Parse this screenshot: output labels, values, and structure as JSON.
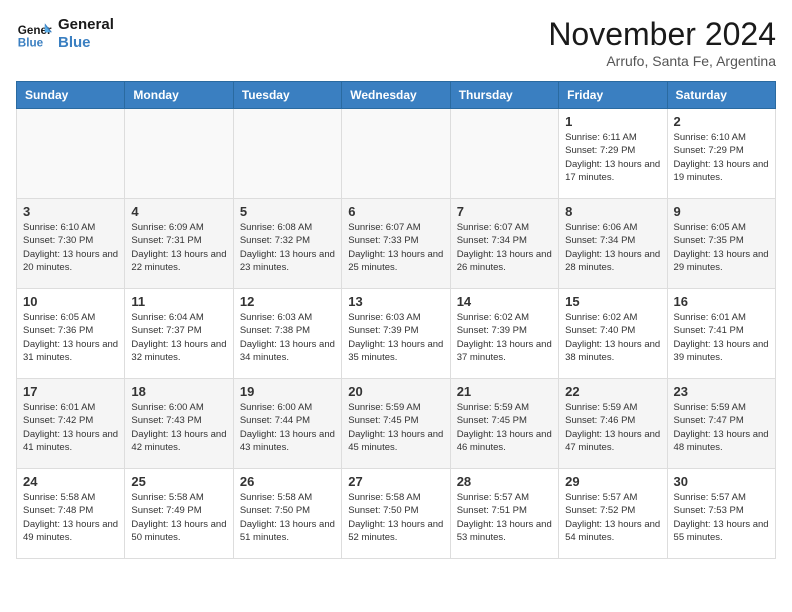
{
  "header": {
    "logo_line1": "General",
    "logo_line2": "Blue",
    "month_title": "November 2024",
    "subtitle": "Arrufo, Santa Fe, Argentina"
  },
  "weekdays": [
    "Sunday",
    "Monday",
    "Tuesday",
    "Wednesday",
    "Thursday",
    "Friday",
    "Saturday"
  ],
  "weeks": [
    [
      {
        "day": "",
        "info": ""
      },
      {
        "day": "",
        "info": ""
      },
      {
        "day": "",
        "info": ""
      },
      {
        "day": "",
        "info": ""
      },
      {
        "day": "",
        "info": ""
      },
      {
        "day": "1",
        "info": "Sunrise: 6:11 AM\nSunset: 7:29 PM\nDaylight: 13 hours and 17 minutes."
      },
      {
        "day": "2",
        "info": "Sunrise: 6:10 AM\nSunset: 7:29 PM\nDaylight: 13 hours and 19 minutes."
      }
    ],
    [
      {
        "day": "3",
        "info": "Sunrise: 6:10 AM\nSunset: 7:30 PM\nDaylight: 13 hours and 20 minutes."
      },
      {
        "day": "4",
        "info": "Sunrise: 6:09 AM\nSunset: 7:31 PM\nDaylight: 13 hours and 22 minutes."
      },
      {
        "day": "5",
        "info": "Sunrise: 6:08 AM\nSunset: 7:32 PM\nDaylight: 13 hours and 23 minutes."
      },
      {
        "day": "6",
        "info": "Sunrise: 6:07 AM\nSunset: 7:33 PM\nDaylight: 13 hours and 25 minutes."
      },
      {
        "day": "7",
        "info": "Sunrise: 6:07 AM\nSunset: 7:34 PM\nDaylight: 13 hours and 26 minutes."
      },
      {
        "day": "8",
        "info": "Sunrise: 6:06 AM\nSunset: 7:34 PM\nDaylight: 13 hours and 28 minutes."
      },
      {
        "day": "9",
        "info": "Sunrise: 6:05 AM\nSunset: 7:35 PM\nDaylight: 13 hours and 29 minutes."
      }
    ],
    [
      {
        "day": "10",
        "info": "Sunrise: 6:05 AM\nSunset: 7:36 PM\nDaylight: 13 hours and 31 minutes."
      },
      {
        "day": "11",
        "info": "Sunrise: 6:04 AM\nSunset: 7:37 PM\nDaylight: 13 hours and 32 minutes."
      },
      {
        "day": "12",
        "info": "Sunrise: 6:03 AM\nSunset: 7:38 PM\nDaylight: 13 hours and 34 minutes."
      },
      {
        "day": "13",
        "info": "Sunrise: 6:03 AM\nSunset: 7:39 PM\nDaylight: 13 hours and 35 minutes."
      },
      {
        "day": "14",
        "info": "Sunrise: 6:02 AM\nSunset: 7:39 PM\nDaylight: 13 hours and 37 minutes."
      },
      {
        "day": "15",
        "info": "Sunrise: 6:02 AM\nSunset: 7:40 PM\nDaylight: 13 hours and 38 minutes."
      },
      {
        "day": "16",
        "info": "Sunrise: 6:01 AM\nSunset: 7:41 PM\nDaylight: 13 hours and 39 minutes."
      }
    ],
    [
      {
        "day": "17",
        "info": "Sunrise: 6:01 AM\nSunset: 7:42 PM\nDaylight: 13 hours and 41 minutes."
      },
      {
        "day": "18",
        "info": "Sunrise: 6:00 AM\nSunset: 7:43 PM\nDaylight: 13 hours and 42 minutes."
      },
      {
        "day": "19",
        "info": "Sunrise: 6:00 AM\nSunset: 7:44 PM\nDaylight: 13 hours and 43 minutes."
      },
      {
        "day": "20",
        "info": "Sunrise: 5:59 AM\nSunset: 7:45 PM\nDaylight: 13 hours and 45 minutes."
      },
      {
        "day": "21",
        "info": "Sunrise: 5:59 AM\nSunset: 7:45 PM\nDaylight: 13 hours and 46 minutes."
      },
      {
        "day": "22",
        "info": "Sunrise: 5:59 AM\nSunset: 7:46 PM\nDaylight: 13 hours and 47 minutes."
      },
      {
        "day": "23",
        "info": "Sunrise: 5:59 AM\nSunset: 7:47 PM\nDaylight: 13 hours and 48 minutes."
      }
    ],
    [
      {
        "day": "24",
        "info": "Sunrise: 5:58 AM\nSunset: 7:48 PM\nDaylight: 13 hours and 49 minutes."
      },
      {
        "day": "25",
        "info": "Sunrise: 5:58 AM\nSunset: 7:49 PM\nDaylight: 13 hours and 50 minutes."
      },
      {
        "day": "26",
        "info": "Sunrise: 5:58 AM\nSunset: 7:50 PM\nDaylight: 13 hours and 51 minutes."
      },
      {
        "day": "27",
        "info": "Sunrise: 5:58 AM\nSunset: 7:50 PM\nDaylight: 13 hours and 52 minutes."
      },
      {
        "day": "28",
        "info": "Sunrise: 5:57 AM\nSunset: 7:51 PM\nDaylight: 13 hours and 53 minutes."
      },
      {
        "day": "29",
        "info": "Sunrise: 5:57 AM\nSunset: 7:52 PM\nDaylight: 13 hours and 54 minutes."
      },
      {
        "day": "30",
        "info": "Sunrise: 5:57 AM\nSunset: 7:53 PM\nDaylight: 13 hours and 55 minutes."
      }
    ]
  ]
}
